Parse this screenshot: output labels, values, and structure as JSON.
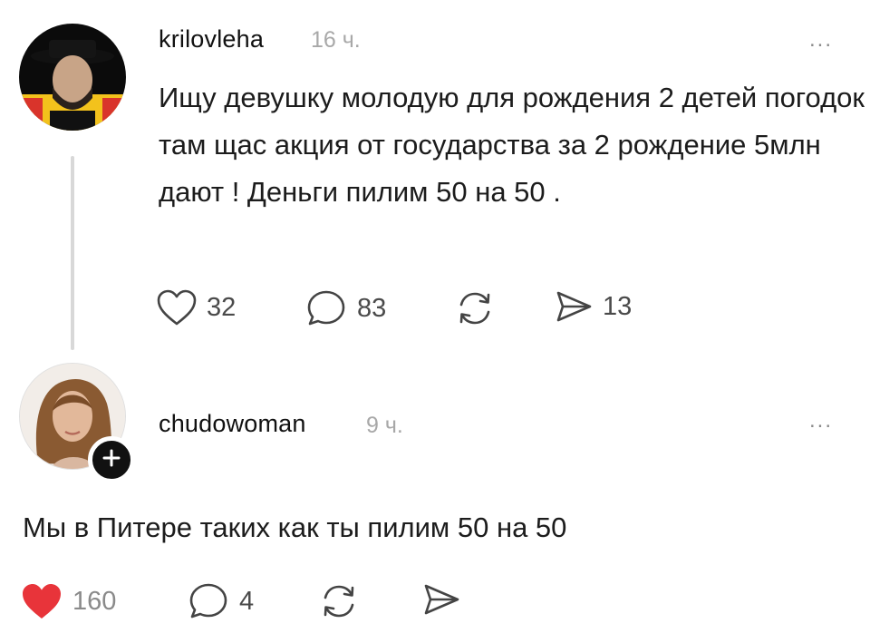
{
  "post": {
    "username": "krilovleha",
    "time": "16 ч.",
    "more": "...",
    "text": "Ищу девушку молодую для рождения 2 детей погодок там щас акция от государства за 2 рождение 5млн дают !  Деньги пилим 50 на 50 .",
    "actions": {
      "likes": "32",
      "comments": "83",
      "shares": "13"
    }
  },
  "reply": {
    "username": "chudowoman",
    "time": "9 ч.",
    "more": "...",
    "text": "Мы в Питере таких как ты пилим 50 на 50",
    "actions": {
      "likes": "160",
      "comments": "4"
    }
  },
  "colors": {
    "liked_heart": "#e8343a",
    "muted": "#a8a8a8",
    "icon": "#444444"
  },
  "icons": [
    "heart-outline-icon",
    "comment-icon",
    "repost-icon",
    "share-icon",
    "heart-filled-icon",
    "more-icon",
    "plus-icon"
  ]
}
